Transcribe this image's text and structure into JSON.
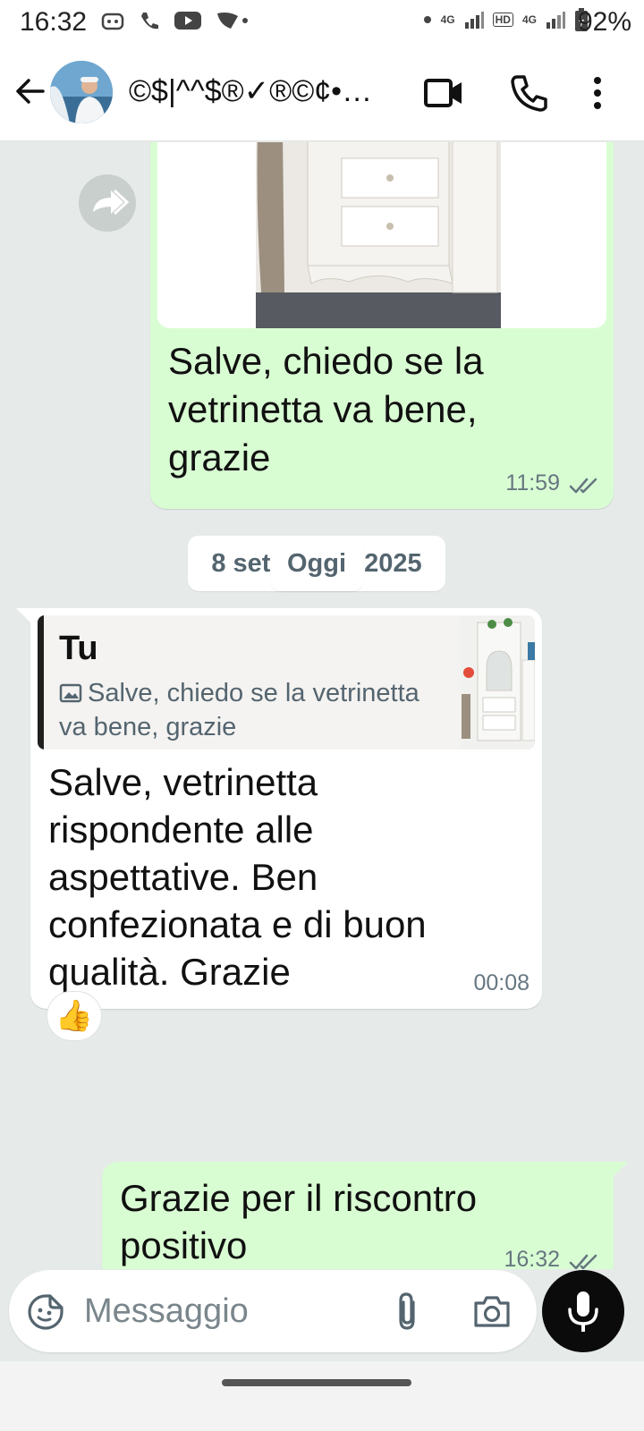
{
  "status_bar": {
    "time": "16:32",
    "network_1": "4G",
    "network_2": "4G",
    "hd": "HD",
    "battery": "92%",
    "icons": [
      "discord-icon",
      "wifi-call-icon",
      "youtube-icon",
      "radar-icon",
      "signal-icon",
      "battery-icon"
    ]
  },
  "header": {
    "contact_name": "©$|^^$®✓®©¢•…",
    "icons": [
      "back-arrow-icon",
      "video-call-icon",
      "phone-icon",
      "more-vert-icon"
    ]
  },
  "messages": [
    {
      "direction": "outgoing",
      "has_image": true,
      "text": "Salve, chiedo se la vetrinetta va bene, grazie",
      "time": "11:59",
      "status": "read"
    },
    {
      "type": "date_separator",
      "label": "8 settembre 2025"
    },
    {
      "direction": "incoming",
      "quote": {
        "author": "Tu",
        "text": "Salve, chiedo se la vetrinetta va bene, grazie"
      },
      "text": "Salve, vetrinetta rispondente alle aspettative. Ben confezionata e di buon qualità. Grazie",
      "time": "00:08",
      "reaction": "👍"
    },
    {
      "type": "date_separator",
      "label": "Oggi"
    },
    {
      "direction": "outgoing",
      "text": "Grazie per il riscontro positivo",
      "time": "16:32",
      "status": "read"
    }
  ],
  "composer": {
    "placeholder": "Messaggio",
    "icons": [
      "sticker-icon",
      "attach-icon",
      "camera-icon",
      "mic-icon"
    ]
  },
  "colors": {
    "outgoing_bubble": "#d9fdd3",
    "incoming_bubble": "#ffffff",
    "chat_background": "#e6ebe9",
    "read_ticks": "#667781"
  }
}
